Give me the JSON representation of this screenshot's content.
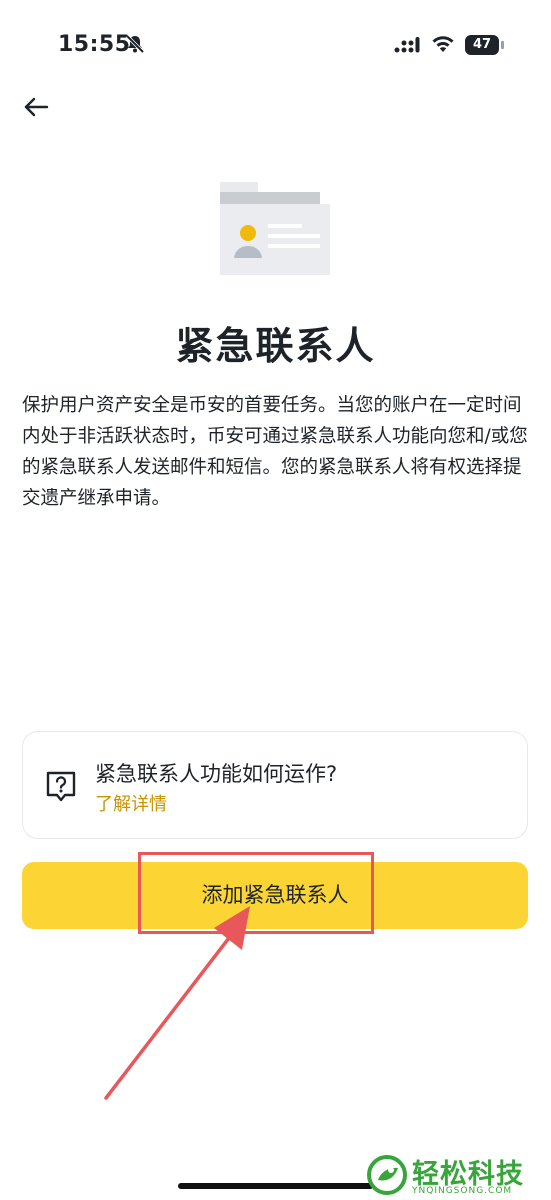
{
  "status_bar": {
    "time": "15:55",
    "battery": "47"
  },
  "page": {
    "title": "紧急联系人",
    "description": "保护用户资产安全是币安的首要任务。当您的账户在一定时间内处于非活跃状态时，币安可通过紧急联系人功能向您和/或您的紧急联系人发送邮件和短信。您的紧急联系人将有权选择提交遗产继承申请。"
  },
  "info_card": {
    "title": "紧急联系人功能如何运作?",
    "link": "了解详情",
    "icon": "question-bubble-icon"
  },
  "primary_button": {
    "label": "添加紧急联系人"
  },
  "watermark": {
    "text": "轻松科技",
    "sub": "YNQINGSONG.COM"
  },
  "colors": {
    "accent": "#fcd535",
    "link": "#c99400",
    "highlight": "#e8585b"
  }
}
